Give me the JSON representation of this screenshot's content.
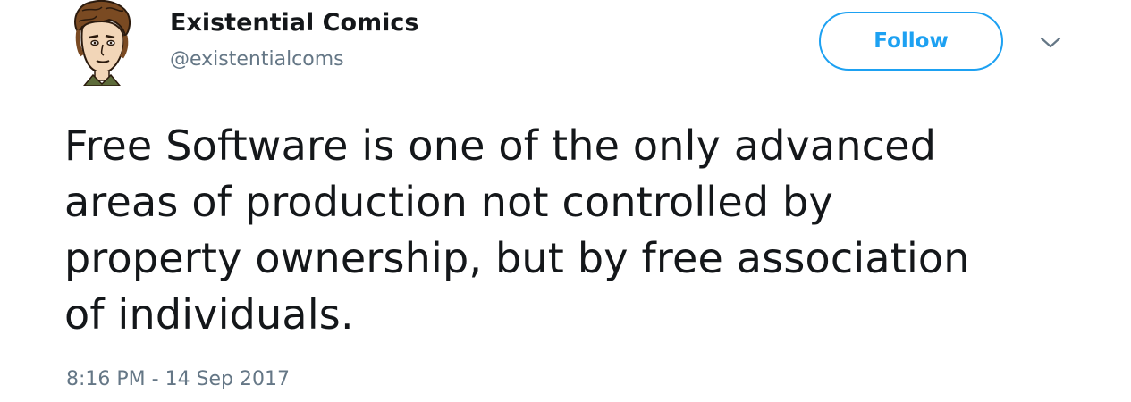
{
  "user": {
    "display_name": "Existential Comics",
    "handle": "@existentialcoms",
    "avatar_icon": "cartoon-portrait-avatar"
  },
  "actions": {
    "follow_label": "Follow",
    "menu_icon": "chevron-down-icon"
  },
  "tweet": {
    "text_lines": [
      "Free Software is one of the only advanced",
      "areas of production not controlled by",
      "property ownership, but by free association",
      "of individuals."
    ],
    "timestamp": "8:16 PM - 14 Sep 2017"
  },
  "colors": {
    "accent": "#1da1f2",
    "text_primary": "#14171a",
    "text_secondary": "#657786"
  }
}
